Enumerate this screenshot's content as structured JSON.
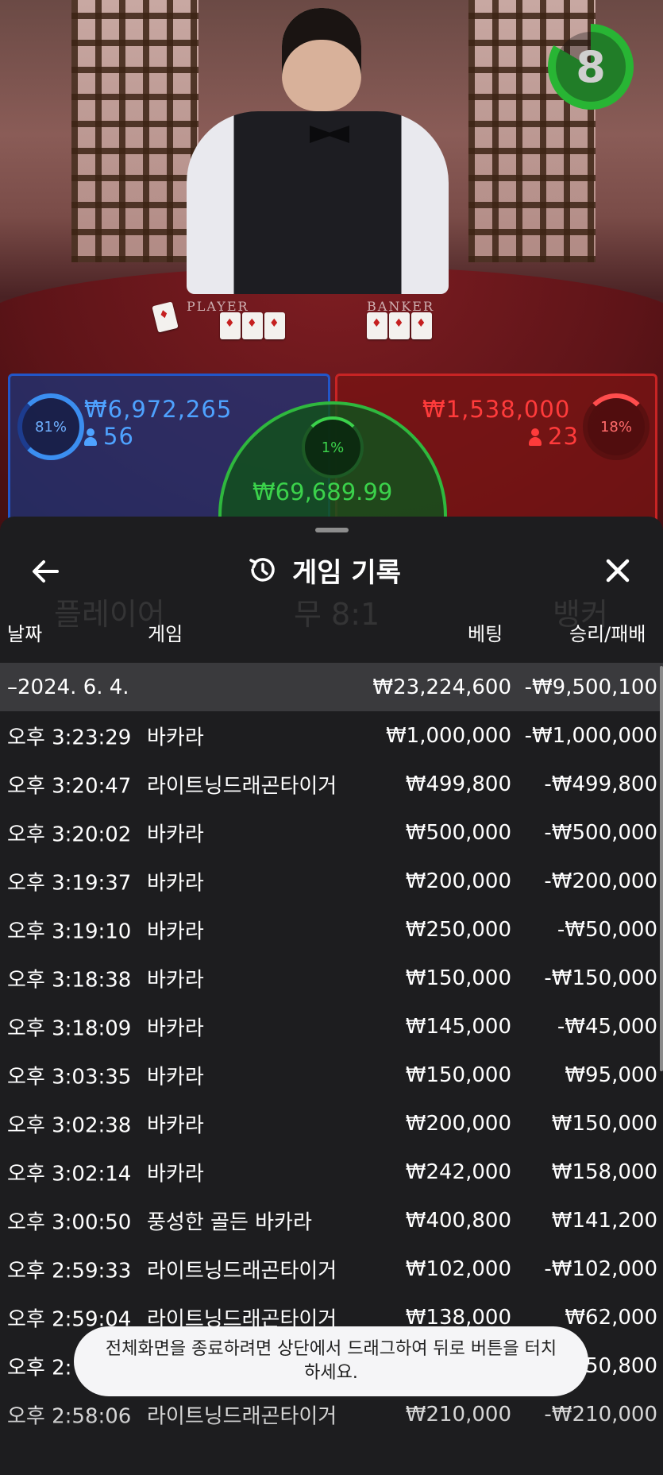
{
  "live": {
    "table_labels": {
      "player": "PLAYER",
      "banker": "BANKER"
    },
    "countdown": "8",
    "player": {
      "percent": "81%",
      "amount": "₩6,972,265",
      "players": "56"
    },
    "banker": {
      "percent": "18%",
      "amount": "₩1,538,000",
      "players": "23"
    },
    "tie": {
      "percent": "1%",
      "amount": "₩69,689.99"
    }
  },
  "colors": {
    "player": "#4ea2ff",
    "banker": "#ff3b3b",
    "tie": "#3bd24b",
    "sheet_bg": "#1d1d1f",
    "date_row_bg": "#3a3a3d"
  },
  "sheet": {
    "title": "게임 기록",
    "icons": {
      "back": "arrow-left-icon",
      "title": "history-icon",
      "close": "close-icon"
    },
    "background_labels": [
      "플레이어",
      "무 8:1",
      "뱅커"
    ],
    "columns": {
      "date": "날짜",
      "game": "게임",
      "bet": "베팅",
      "result": "승리/패배"
    },
    "date_row": {
      "date": "–2024. 6. 4.",
      "bet": "₩23,224,600",
      "result": "-₩9,500,100"
    },
    "rows": [
      {
        "time": "오후 3:23:29",
        "game": "바카라",
        "bet": "₩1,000,000",
        "result": "-₩1,000,000"
      },
      {
        "time": "오후 3:20:47",
        "game": "라이트닝드래곤타이거",
        "bet": "₩499,800",
        "result": "-₩499,800"
      },
      {
        "time": "오후 3:20:02",
        "game": "바카라",
        "bet": "₩500,000",
        "result": "-₩500,000"
      },
      {
        "time": "오후 3:19:37",
        "game": "바카라",
        "bet": "₩200,000",
        "result": "-₩200,000"
      },
      {
        "time": "오후 3:19:10",
        "game": "바카라",
        "bet": "₩250,000",
        "result": "-₩50,000"
      },
      {
        "time": "오후 3:18:38",
        "game": "바카라",
        "bet": "₩150,000",
        "result": "-₩150,000"
      },
      {
        "time": "오후 3:18:09",
        "game": "바카라",
        "bet": "₩145,000",
        "result": "-₩45,000"
      },
      {
        "time": "오후 3:03:35",
        "game": "바카라",
        "bet": "₩150,000",
        "result": "₩95,000"
      },
      {
        "time": "오후 3:02:38",
        "game": "바카라",
        "bet": "₩200,000",
        "result": "₩150,000"
      },
      {
        "time": "오후 3:02:14",
        "game": "바카라",
        "bet": "₩242,000",
        "result": "₩158,000"
      },
      {
        "time": "오후 3:00:50",
        "game": "풍성한 골든 바카라",
        "bet": "₩400,800",
        "result": "₩141,200"
      },
      {
        "time": "오후 2:59:33",
        "game": "라이트닝드래곤타이거",
        "bet": "₩102,000",
        "result": "-₩102,000"
      },
      {
        "time": "오후 2:59:04",
        "game": "라이트닝드래곤타이거",
        "bet": "₩138,000",
        "result": "₩62,000"
      },
      {
        "time": "오후 2:",
        "game": "",
        "bet": "",
        "result": "50,800"
      },
      {
        "time": "오후 2:58:06",
        "game": "라이트닝드래곤타이거",
        "bet": "₩210,000",
        "result": "-₩210,000"
      }
    ]
  },
  "toast": {
    "message": "전체화면을 종료하려면 상단에서 드래그하여 뒤로 버튼을 터치하세요."
  }
}
